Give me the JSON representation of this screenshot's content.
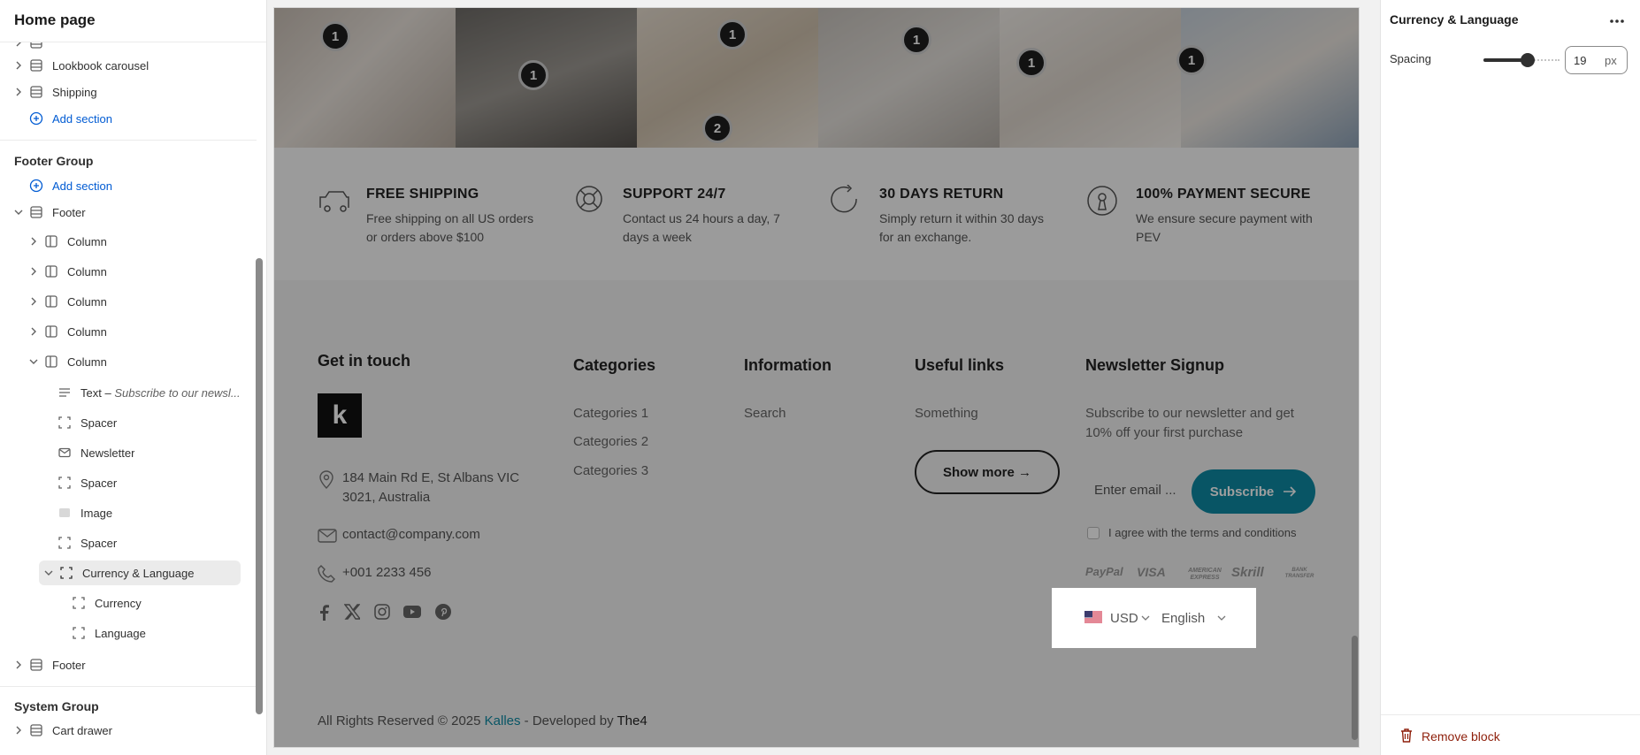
{
  "sidebar": {
    "title": "Home page",
    "items": [
      {
        "label": "Lookbook carousel"
      },
      {
        "label": "Shipping"
      },
      {
        "label": "Add section"
      },
      {
        "label": "Footer Group"
      },
      {
        "label": "Add section"
      },
      {
        "label": "Footer"
      },
      {
        "label": "Column"
      },
      {
        "label": "Column"
      },
      {
        "label": "Column"
      },
      {
        "label": "Column"
      },
      {
        "label": "Column"
      },
      {
        "label": "Text",
        "detail": "Subscribe to our newsl..."
      },
      {
        "label": "Spacer"
      },
      {
        "label": "Newsletter"
      },
      {
        "label": "Spacer"
      },
      {
        "label": "Image"
      },
      {
        "label": "Spacer"
      },
      {
        "label": "Currency & Language"
      },
      {
        "label": "Currency"
      },
      {
        "label": "Language"
      },
      {
        "label": "Footer"
      },
      {
        "label": "System Group"
      },
      {
        "label": "Cart drawer"
      }
    ],
    "text_separator": " – "
  },
  "preview": {
    "hotspots": [
      "1",
      "1",
      "1",
      "1",
      "1",
      "1",
      "2"
    ],
    "features": [
      {
        "title": "FREE SHIPPING",
        "desc": "Free shipping on all US orders or orders above $100"
      },
      {
        "title": "SUPPORT 24/7",
        "desc": "Contact us 24 hours a day, 7 days a week"
      },
      {
        "title": "30 DAYS RETURN",
        "desc": "Simply return it within 30 days for an exchange."
      },
      {
        "title": "100% PAYMENT SECURE",
        "desc": "We ensure secure payment with PEV"
      }
    ],
    "footer": {
      "get_in_touch": "Get in touch",
      "logo_letter": "k",
      "address": "184 Main Rd E, St Albans VIC 3021, Australia",
      "email": "contact@company.com",
      "phone": "+001 2233 456",
      "categories_title": "Categories",
      "categories": [
        "Categories 1",
        "Categories 2",
        "Categories 3"
      ],
      "information_title": "Information",
      "information": [
        "Search"
      ],
      "useful_title": "Useful links",
      "useful": [
        "Something"
      ],
      "show_more": "Show more →",
      "newsletter_title": "Newsletter Signup",
      "newsletter_desc": "Subscribe to our newsletter and get 10% off your first purchase",
      "email_placeholder": "Enter email ...",
      "subscribe": "Subscribe",
      "agree": "I agree with the terms and conditions",
      "payments": [
        "PayPal",
        "VISA",
        "AMERICAN EXPRESS",
        "Skrill",
        "BANK TRANSFER"
      ],
      "currency": "USD",
      "language": "English",
      "copyright_pre": "All Rights Reserved © 2025 ",
      "copyright_brand": "Kalles",
      "copyright_mid": " - Developed by ",
      "copyright_dev": "The4"
    }
  },
  "panel": {
    "title": "Currency & Language",
    "spacing_label": "Spacing",
    "spacing_value": "19",
    "spacing_unit": "px",
    "spacing_fraction": 0.58,
    "remove": "Remove block"
  },
  "colors": {
    "accent": "#0e8aa3",
    "link": "#005bd3",
    "danger": "#8e1f0b"
  }
}
